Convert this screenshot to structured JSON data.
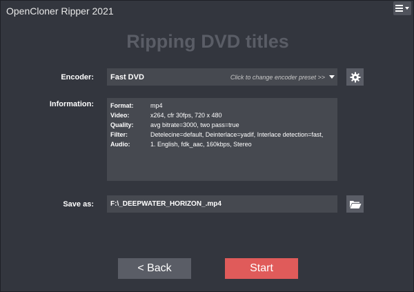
{
  "app": {
    "title": "OpenCloner Ripper 2021"
  },
  "page": {
    "heading": "Ripping DVD titles"
  },
  "encoder": {
    "label": "Encoder:",
    "value": "Fast DVD",
    "hint": "Click to change encoder preset >>"
  },
  "information": {
    "label": "Information:",
    "rows": [
      {
        "key": "Format:",
        "value": "mp4"
      },
      {
        "key": "Video:",
        "value": "x264, cfr 30fps, 720 x 480"
      },
      {
        "key": "Quality:",
        "value": "avg bitrate=3000, two pass=true"
      },
      {
        "key": "Filter:",
        "value": "Detelecine=default, Deinterlace=yadif, Interlace detection=fast,"
      },
      {
        "key": "Audio:",
        "value": "1. English, fdk_aac, 160kbps, Stereo"
      }
    ]
  },
  "save_as": {
    "label": "Save as:",
    "value": "F:\\_DEEPWATER_HORIZON_.mp4"
  },
  "buttons": {
    "back": "<  Back",
    "start": "Start"
  },
  "icons": {
    "menu": "hamburger-menu-icon",
    "settings": "gear-icon",
    "browse": "folder-open-icon"
  },
  "colors": {
    "background": "#33363e",
    "field": "#464950",
    "button": "#5a5d66",
    "accent": "#e05b5a"
  }
}
